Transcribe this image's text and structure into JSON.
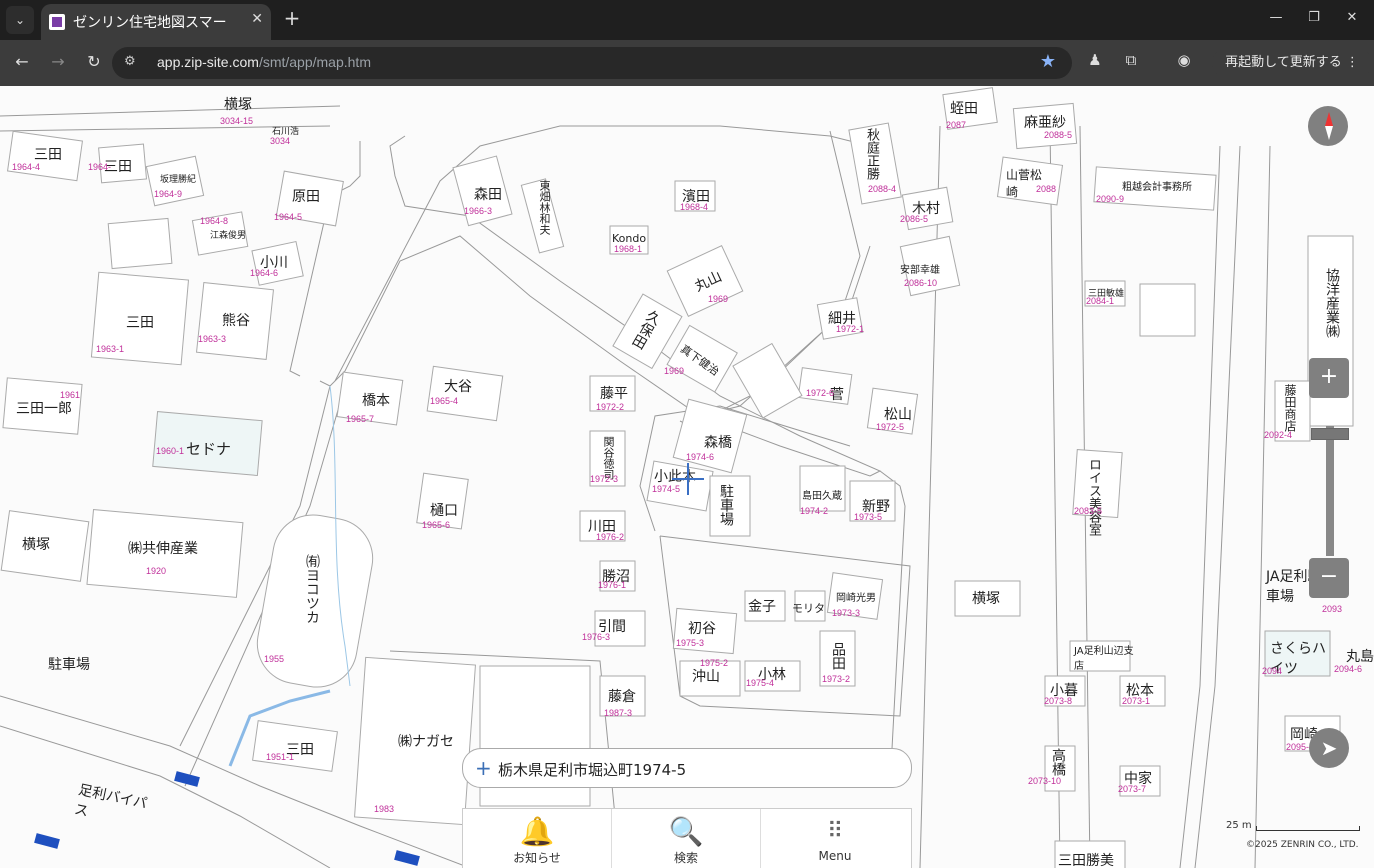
{
  "browser": {
    "tab_title": "ゼンリン住宅地図スマー",
    "url_host": "app.zip-site.com",
    "url_path": "/smt/app/map.htm",
    "relaunch_label": "再起動して更新する"
  },
  "map": {
    "labels": [
      {
        "t": "三田",
        "c": "1964-4"
      },
      {
        "t": "三田",
        "c": "1964-"
      },
      {
        "t": "坂理勝紀",
        "c": "1964-9"
      },
      {
        "t": "原田",
        "c": "1964-5"
      },
      {
        "t": "江森俊男",
        "c": "1964-8"
      },
      {
        "t": "小川",
        "c": "1964-6"
      },
      {
        "t": "三田",
        "c": "1963-1"
      },
      {
        "t": "熊谷",
        "c": "1963-3"
      },
      {
        "t": "三田一郎",
        "c": "1961"
      },
      {
        "t": "セドナ",
        "c": "1960-1"
      },
      {
        "t": "横塚",
        "c": "1920"
      },
      {
        "t": "㈱共伸産業",
        "c": "1920"
      },
      {
        "t": "駐車場",
        "c": ""
      },
      {
        "t": "㈲ヨコツカ",
        "c": "1955"
      },
      {
        "t": "三田",
        "c": "1951-1"
      },
      {
        "t": "㈱ナガセ",
        "c": "1983"
      },
      {
        "t": "足利バイパス",
        "c": ""
      },
      {
        "t": "横塚",
        "c": "3034-15"
      },
      {
        "t": "石川浩",
        "c": "3034"
      },
      {
        "t": "森田",
        "c": "1966-3"
      },
      {
        "t": "東畑林和夫",
        "c": ""
      },
      {
        "t": "濱田",
        "c": "1968-4"
      },
      {
        "t": "Kondo",
        "c": "1968-1"
      },
      {
        "t": "丸山",
        "c": "1969"
      },
      {
        "t": "久保田",
        "c": ""
      },
      {
        "t": "真下健治",
        "c": "1969"
      },
      {
        "t": "橋本",
        "c": "1965-7"
      },
      {
        "t": "大谷",
        "c": "1965-4"
      },
      {
        "t": "樋口",
        "c": "1965-6"
      },
      {
        "t": "藤平",
        "c": "1972-2"
      },
      {
        "t": "関谷徳司",
        "c": "1972-3"
      },
      {
        "t": "森橋",
        "c": "1974-6"
      },
      {
        "t": "小此木",
        "c": "1974-5"
      },
      {
        "t": "駐車場",
        "c": ""
      },
      {
        "t": "川田",
        "c": "1976-2"
      },
      {
        "t": "勝沼",
        "c": "1976-1"
      },
      {
        "t": "引間",
        "c": "1976-3"
      },
      {
        "t": "初谷",
        "c": "1975-3"
      },
      {
        "t": "金子",
        "c": ""
      },
      {
        "t": "モリタ",
        "c": ""
      },
      {
        "t": "岡崎光男",
        "c": "1973-3"
      },
      {
        "t": "沖山",
        "c": "1975-2"
      },
      {
        "t": "小林",
        "c": "1975-4"
      },
      {
        "t": "品田",
        "c": "1973-2"
      },
      {
        "t": "藤倉",
        "c": "1987-3"
      },
      {
        "t": "島田久蔵",
        "c": "1974-2"
      },
      {
        "t": "新野",
        "c": "1973-5"
      },
      {
        "t": "菅",
        "c": "1972-6"
      },
      {
        "t": "松山",
        "c": "1972-5"
      },
      {
        "t": "細井",
        "c": "1972-1"
      },
      {
        "t": "蛭田",
        "c": "2087"
      },
      {
        "t": "麻亜紗",
        "c": "2088-5"
      },
      {
        "t": "秋庭正勝",
        "c": "2088-4"
      },
      {
        "t": "木村",
        "c": "2086-5"
      },
      {
        "t": "山菅松崎",
        "c": "2088"
      },
      {
        "t": "安部幸雄",
        "c": "2086-10"
      },
      {
        "t": "粗越会計事務所",
        "c": "2090-9"
      },
      {
        "t": "三田敏雄",
        "c": "2084-1"
      },
      {
        "t": "ロイス美容室",
        "c": "2083-5"
      },
      {
        "t": "横塚",
        "c": ""
      },
      {
        "t": "JA足利山辺支店",
        "c": ""
      },
      {
        "t": "小暮",
        "c": "2073-8"
      },
      {
        "t": "松本",
        "c": "2073-1"
      },
      {
        "t": "高橋",
        "c": "2073-10"
      },
      {
        "t": "中家",
        "c": "2073-7"
      },
      {
        "t": "三田勝美",
        "c": ""
      },
      {
        "t": "協洋産業㈱",
        "c": ""
      },
      {
        "t": "藤田商店",
        "c": "2092-4"
      },
      {
        "t": "JA足利駐車場",
        "c": "2093"
      },
      {
        "t": "さくらハイツ",
        "c": "2094"
      },
      {
        "t": "丸島",
        "c": "2094-6"
      },
      {
        "t": "岡崎",
        "c": "2095-5"
      }
    ]
  },
  "controls": {
    "compass_icon": "compass-icon",
    "zoom_in": "+",
    "zoom_out": "−",
    "locate_icon": "location-arrow-icon"
  },
  "search": {
    "address": "栃木県足利市堀込町1974-5"
  },
  "bottom_nav": {
    "news": "お知らせ",
    "search": "検索",
    "menu": "Menu"
  },
  "scale_label": "25 m",
  "copyright": "©2025 ZENRIN CO., LTD."
}
